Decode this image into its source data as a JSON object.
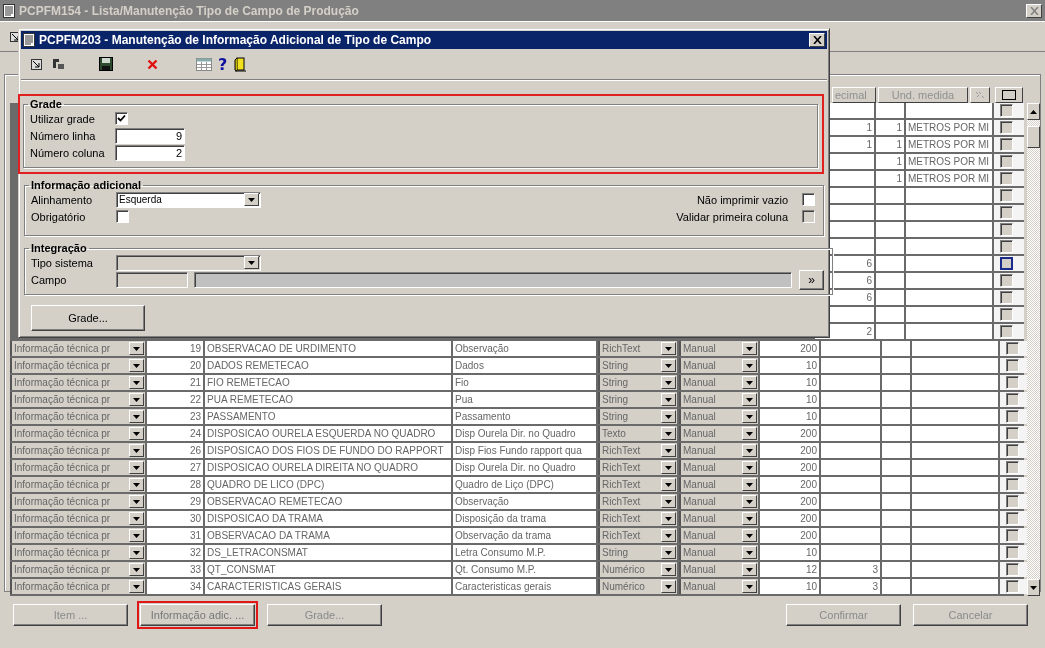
{
  "window": {
    "title": "PCPFM154 - Lista/Manutenção Tipo de Campo de Produção"
  },
  "table": {
    "headers": [
      "ecimal",
      "Und. medida"
    ],
    "upper_rows": [
      {
        "checked": false,
        "focused": false
      },
      {
        "decimal": "1",
        "unit_code": "1",
        "unit": "METROS POR MI",
        "checked": false,
        "focused": false
      },
      {
        "decimal": "1",
        "unit_code": "1",
        "unit": "METROS POR MI",
        "checked": false,
        "focused": false
      },
      {
        "unit_code": "1",
        "unit": "METROS POR MI",
        "checked": false,
        "focused": false
      },
      {
        "unit_code": "1",
        "unit": "METROS POR MI",
        "checked": false,
        "focused": false
      },
      {
        "checked": false,
        "focused": false
      },
      {
        "checked": false,
        "focused": false
      },
      {
        "checked": false,
        "focused": false
      },
      {
        "checked": false,
        "focused": false
      },
      {
        "decimal": "6",
        "checked": false,
        "focused": true
      },
      {
        "decimal": "6",
        "checked": false,
        "focused": false
      },
      {
        "decimal": "6",
        "checked": false,
        "focused": false
      },
      {
        "checked": false,
        "focused": false
      },
      {
        "decimal": "2",
        "checked": false,
        "focused": false
      }
    ],
    "rows": [
      {
        "category": "Informação técnica pr",
        "seq": "19",
        "name": "OBSERVACAO DE URDIMENTO",
        "label": "Observação",
        "type": "RichText",
        "mode": "Manual",
        "size": "200",
        "checked": false
      },
      {
        "category": "Informação técnica pr",
        "seq": "20",
        "name": "DADOS REMETECAO",
        "label": "Dados",
        "type": "String",
        "mode": "Manual",
        "size": "10",
        "checked": false
      },
      {
        "category": "Informação técnica pr",
        "seq": "21",
        "name": "FIO REMETECAO",
        "label": "Fio",
        "type": "String",
        "mode": "Manual",
        "size": "10",
        "checked": false
      },
      {
        "category": "Informação técnica pr",
        "seq": "22",
        "name": "PUA REMETECAO",
        "label": "Pua",
        "type": "String",
        "mode": "Manual",
        "size": "10",
        "checked": false
      },
      {
        "category": "Informação técnica pr",
        "seq": "23",
        "name": "PASSAMENTO",
        "label": "Passamento",
        "type": "String",
        "mode": "Manual",
        "size": "10",
        "checked": false
      },
      {
        "category": "Informação técnica pr",
        "seq": "24",
        "name": "DISPOSICAO OURELA ESQUERDA NO QUADRO",
        "label": "Disp Ourela Dir. no Quadro",
        "type": "Texto",
        "mode": "Manual",
        "size": "200",
        "checked": false
      },
      {
        "category": "Informação técnica pr",
        "seq": "26",
        "name": "DISPOSICAO DOS FIOS DE FUNDO DO RAPPORT",
        "label": "Disp Fios Fundo rapport qua",
        "type": "RichText",
        "mode": "Manual",
        "size": "200",
        "checked": false
      },
      {
        "category": "Informação técnica pr",
        "seq": "27",
        "name": "DISPOSICAO OURELA DIREITA NO QUADRO",
        "label": "Disp Ourela Dir. no Quadro",
        "type": "RichText",
        "mode": "Manual",
        "size": "200",
        "checked": false
      },
      {
        "category": "Informação técnica pr",
        "seq": "28",
        "name": "QUADRO DE LICO (DPC)",
        "label": "Quadro de Liço (DPC)",
        "type": "RichText",
        "mode": "Manual",
        "size": "200",
        "checked": false
      },
      {
        "category": "Informação técnica pr",
        "seq": "29",
        "name": "OBSERVACAO REMETECAO",
        "label": "Observação",
        "type": "RichText",
        "mode": "Manual",
        "size": "200",
        "checked": false
      },
      {
        "category": "Informação técnica pr",
        "seq": "30",
        "name": "DISPOSICAO DA TRAMA",
        "label": "Disposição da trama",
        "type": "RichText",
        "mode": "Manual",
        "size": "200",
        "checked": false
      },
      {
        "category": "Informação técnica pr",
        "seq": "31",
        "name": "OBSERVACAO DA TRAMA",
        "label": "Observação da trama",
        "type": "RichText",
        "mode": "Manual",
        "size": "200",
        "checked": false
      },
      {
        "category": "Informação técnica pr",
        "seq": "32",
        "name": "DS_LETRACONSMAT",
        "label": "Letra Consumo M.P.",
        "type": "String",
        "mode": "Manual",
        "size": "10",
        "checked": false
      },
      {
        "category": "Informação técnica pr",
        "seq": "33",
        "name": "QT_CONSMAT",
        "label": "Qt. Consumo M.P.",
        "type": "Numérico",
        "mode": "Manual",
        "size": "12",
        "decimal": "3",
        "checked": false
      },
      {
        "category": "Informação técnica pr",
        "seq": "34",
        "name": "CARACTERISTICAS GERAIS",
        "label": "Caracteristicas gerais",
        "type": "Numérico",
        "mode": "Manual",
        "size": "10",
        "decimal": "3",
        "checked": false
      }
    ]
  },
  "buttons_left": [
    {
      "label": "Item ...",
      "highlighted": false
    },
    {
      "label": "Informação adic. ...",
      "highlighted": true
    },
    {
      "label": "Grade...",
      "highlighted": false
    }
  ],
  "buttons_right": [
    {
      "label": "Confirmar",
      "highlighted": false
    },
    {
      "label": "Cancelar",
      "highlighted": false
    }
  ],
  "dialog": {
    "title": "PCPFM203 - Manutenção de Informação Adicional de Tipo de Campo",
    "help_glyph": "?",
    "grade": {
      "title": "Grade",
      "highlighted": true,
      "use_grid": {
        "label": "Utilizar grade",
        "checked": true
      },
      "line_count": {
        "label": "Número linha",
        "value": "9"
      },
      "column_count": {
        "label": "Número coluna",
        "value": "2"
      }
    },
    "info": {
      "title": "Informação adicional",
      "alignment": {
        "label": "Alinhamento",
        "value": "Esquerda"
      },
      "required": {
        "label": "Obrigatório",
        "checked": false
      },
      "no_print_empty": {
        "label": "Não imprimir vazio",
        "checked": false
      },
      "validate_first": {
        "label": "Validar primeira coluna",
        "checked": false,
        "disabled": true
      }
    },
    "integration": {
      "title": "Integração",
      "system_type": {
        "label": "Tipo sistema",
        "disabled": true
      },
      "field": {
        "label": "Campo",
        "disabled": true
      },
      "browse": "»"
    },
    "grade_button": "Grade..."
  }
}
